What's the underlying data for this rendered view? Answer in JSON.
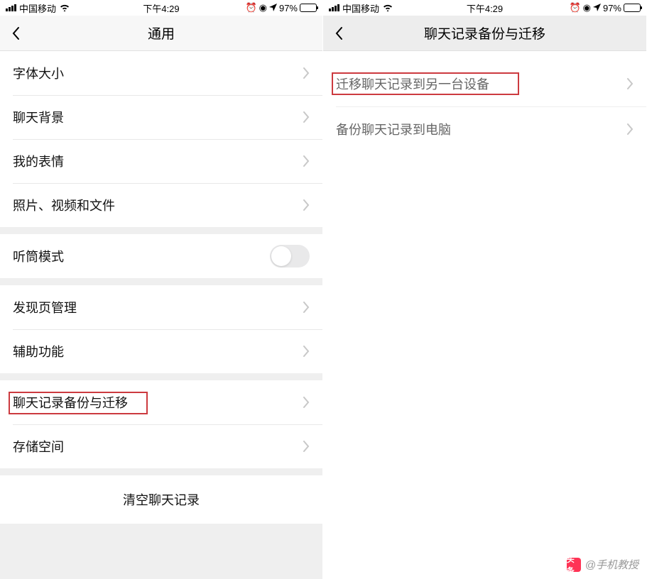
{
  "status": {
    "carrier": "中国移动",
    "time": "下午4:29",
    "battery_pct": "97%"
  },
  "left": {
    "title": "通用",
    "rows": {
      "font_size": "字体大小",
      "chat_bg": "聊天背景",
      "my_stickers": "我的表情",
      "media_files": "照片、视频和文件",
      "earpiece_mode": "听筒模式",
      "discover_mgmt": "发现页管理",
      "accessibility": "辅助功能",
      "backup_migrate": "聊天记录备份与迁移",
      "storage": "存储空间",
      "clear_history": "清空聊天记录"
    }
  },
  "right": {
    "title": "聊天记录备份与迁移",
    "rows": {
      "migrate_device": "迁移聊天记录到另一台设备",
      "backup_pc": "备份聊天记录到电脑"
    }
  },
  "watermark": {
    "logo_text": "头条",
    "text": "@手机教授"
  },
  "colors": {
    "highlight": "#cc3a3f"
  }
}
